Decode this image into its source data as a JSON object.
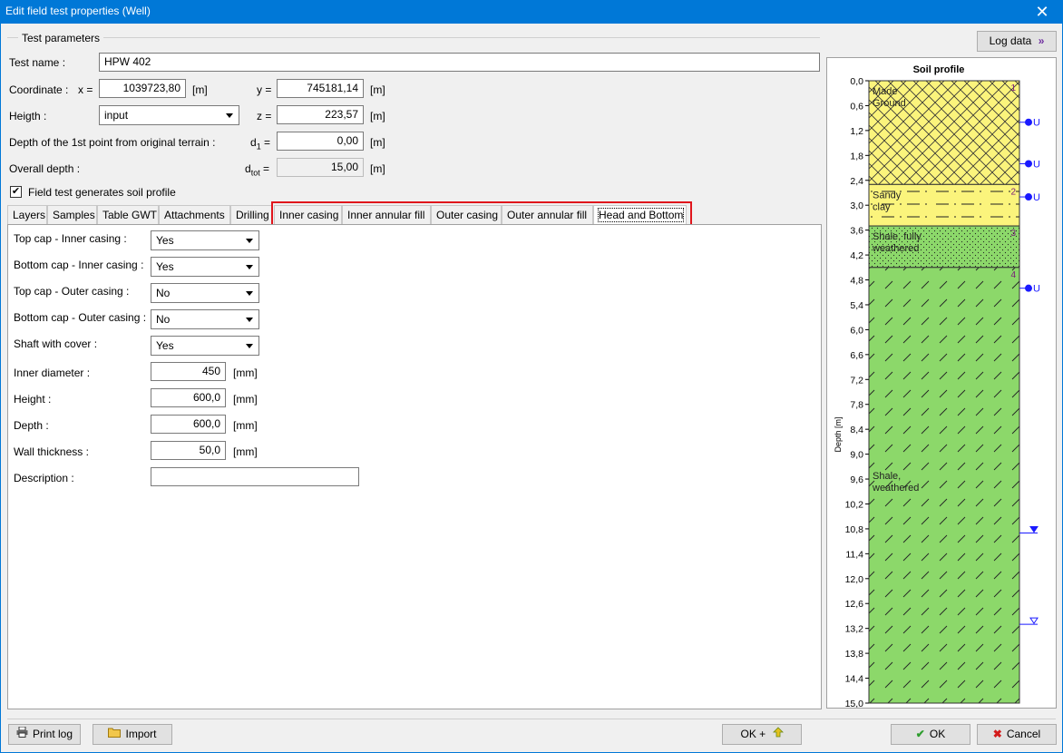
{
  "window": {
    "title": "Edit field test properties (Well)",
    "close_glyph": "✕"
  },
  "params": {
    "group_label": "Test parameters",
    "test_name_label": "Test name :",
    "test_name": "HPW 402",
    "coordinate_label": "Coordinate :",
    "x_label": "x =",
    "x_value": "1039723,80",
    "x_unit": "[m]",
    "y_label": "y =",
    "y_value": "745181,14",
    "y_unit": "[m]",
    "height_label": "Heigth :",
    "height_mode": "input",
    "z_label": "z =",
    "z_value": "223,57",
    "z_unit": "[m]",
    "depth1_label": "Depth of the 1st point from original terrain :",
    "d1_label": "d",
    "d1_sub": "1",
    "d1_eq": " =",
    "d1_value": "0,00",
    "d1_unit": "[m]",
    "overall_label": "Overall depth :",
    "dtot_label": "d",
    "dtot_sub": "tot",
    "dtot_eq": " =",
    "dtot_value": "15,00",
    "dtot_unit": "[m]",
    "generates_label": "Field test generates soil profile",
    "generates_checked": "✔"
  },
  "tabs": [
    "Layers",
    "Samples",
    "Table GWT",
    "Attachments",
    "Drilling",
    "Inner casing",
    "Inner annular fill",
    "Outer casing",
    "Outer annular fill",
    "Head and Bottom"
  ],
  "head_bottom": {
    "top_cap_inner_label": "Top cap - Inner casing :",
    "top_cap_inner": "Yes",
    "bottom_cap_inner_label": "Bottom cap - Inner casing :",
    "bottom_cap_inner": "Yes",
    "top_cap_outer_label": "Top cap - Outer casing :",
    "top_cap_outer": "No",
    "bottom_cap_outer_label": "Bottom cap - Outer casing :",
    "bottom_cap_outer": "No",
    "shaft_cover_label": "Shaft with cover :",
    "shaft_cover": "Yes",
    "inner_diameter_label": "Inner diameter :",
    "inner_diameter": "450",
    "inner_diameter_unit": "[mm]",
    "height_label": "Height :",
    "height": "600,0",
    "height_unit": "[mm]",
    "depth_label": "Depth :",
    "depth": "600,0",
    "depth_unit": "[mm]",
    "wall_label": "Wall thickness :",
    "wall": "50,0",
    "wall_unit": "[mm]",
    "description_label": "Description :",
    "description": ""
  },
  "log_data_button": "Log data",
  "profile": {
    "title": "Soil profile",
    "axis_label": "Depth [m]",
    "depth_max": 15.0,
    "ticks": [
      "0,0",
      "0,6",
      "1,2",
      "1,8",
      "2,4",
      "3,0",
      "3,6",
      "4,2",
      "4,8",
      "5,4",
      "6,0",
      "6,6",
      "7,2",
      "7,8",
      "8,4",
      "9,0",
      "9,6",
      "10,2",
      "10,8",
      "11,4",
      "12,0",
      "12,6",
      "13,2",
      "13,8",
      "14,4",
      "15,0"
    ],
    "layers": [
      {
        "num": "1",
        "from": 0.0,
        "to": 2.5,
        "name_lines": [
          "Made",
          "Ground"
        ],
        "color": "#fbf47c"
      },
      {
        "num": "2",
        "from": 2.5,
        "to": 3.5,
        "name_lines": [
          "Sandy",
          "clay"
        ],
        "color": "#fbf47c"
      },
      {
        "num": "3",
        "from": 3.5,
        "to": 4.5,
        "name_lines": [
          "Shale, fully",
          "weathered"
        ],
        "color": "#8cd86a"
      },
      {
        "num": "4",
        "from": 4.5,
        "to": 15.0,
        "name_lines": [
          "Shale,",
          "weathered"
        ],
        "color": "#8cd86a"
      }
    ],
    "markers": [
      {
        "depth": 1.0,
        "label": "U"
      },
      {
        "depth": 2.0,
        "label": "U"
      },
      {
        "depth": 2.8,
        "label": "U"
      },
      {
        "depth": 5.0,
        "label": "U"
      }
    ],
    "water_levels": [
      10.9,
      13.1
    ]
  },
  "footer": {
    "print_log": "Print log",
    "import": "Import",
    "ok_plus": "OK +",
    "ok": "OK",
    "cancel": "Cancel"
  }
}
